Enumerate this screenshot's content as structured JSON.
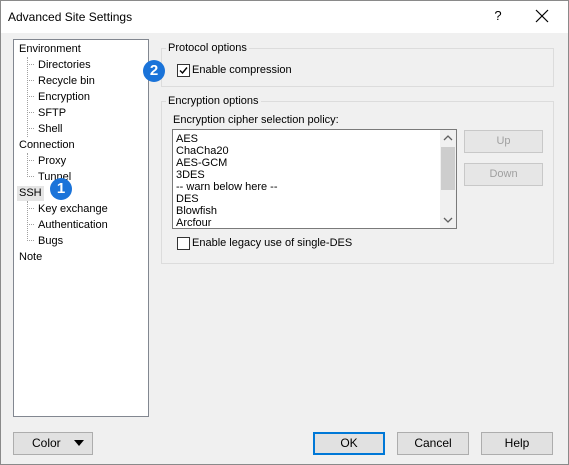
{
  "window": {
    "title": "Advanced Site Settings",
    "help_label": "?"
  },
  "tree": {
    "items": [
      {
        "label": "Environment"
      },
      {
        "label": "Directories"
      },
      {
        "label": "Recycle bin"
      },
      {
        "label": "Encryption"
      },
      {
        "label": "SFTP"
      },
      {
        "label": "Shell"
      },
      {
        "label": "Connection"
      },
      {
        "label": "Proxy"
      },
      {
        "label": "Tunnel"
      },
      {
        "label": "SSH"
      },
      {
        "label": "Key exchange"
      },
      {
        "label": "Authentication"
      },
      {
        "label": "Bugs"
      },
      {
        "label": "Note"
      }
    ]
  },
  "protocol_options": {
    "title": "Protocol options",
    "enable_compression_label": "Enable compression",
    "enable_compression_checked": true
  },
  "encryption_options": {
    "title": "Encryption options",
    "policy_label": "Encryption cipher selection policy:",
    "ciphers": [
      "AES",
      "ChaCha20",
      "AES-GCM",
      "3DES",
      "-- warn below here --",
      "DES",
      "Blowfish",
      "Arcfour"
    ],
    "up_label": "Up",
    "down_label": "Down",
    "legacy_des_label": "Enable legacy use of single-DES",
    "legacy_des_checked": false
  },
  "badges": {
    "one": "1",
    "two": "2"
  },
  "footer": {
    "color_label": "Color",
    "ok_label": "OK",
    "cancel_label": "Cancel",
    "help_label": "Help"
  },
  "colors": {
    "badge": "#1a73d9",
    "default_button_border": "#0078d7"
  }
}
